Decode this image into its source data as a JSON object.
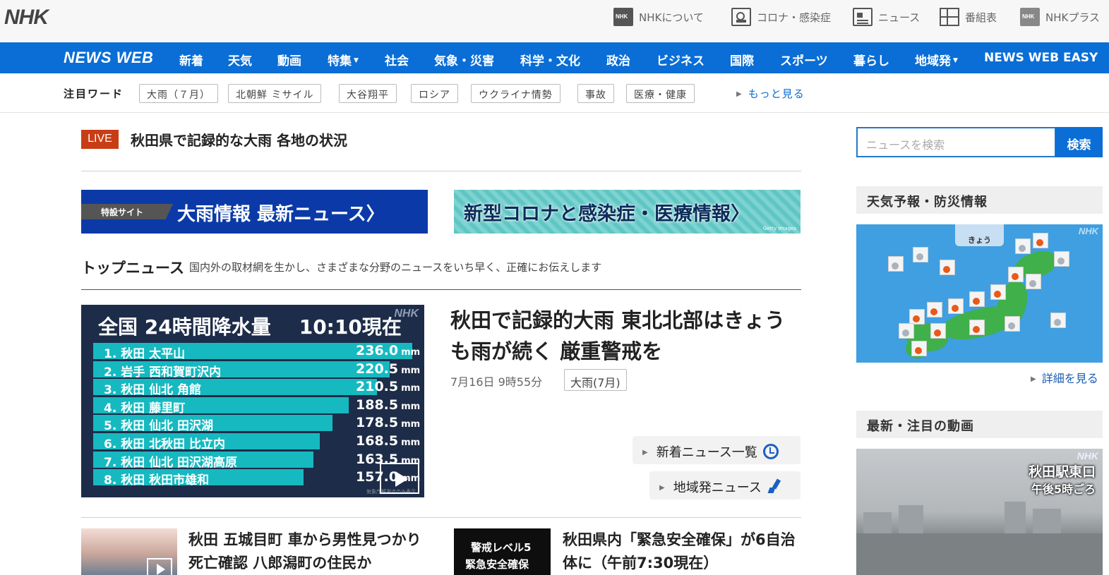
{
  "header": {
    "logo": "NHK",
    "links": [
      {
        "label": "NHKについて",
        "icon": "nhk-logo-icon"
      },
      {
        "label": "コロナ・感染症",
        "icon": "virus-icon"
      },
      {
        "label": "ニュース",
        "icon": "newspaper-icon"
      },
      {
        "label": "番組表",
        "icon": "grid-icon"
      },
      {
        "label": "NHKプラス",
        "icon": "nhk-plus-icon"
      }
    ]
  },
  "nav": {
    "brand": "NEWS WEB",
    "items": [
      "新着",
      "天気",
      "動画",
      "特集",
      "社会",
      "気象・災害",
      "科学・文化",
      "政治",
      "ビジネス",
      "国際",
      "スポーツ",
      "暮らし",
      "地域発",
      "NEWS WEB EASY"
    ]
  },
  "trending": {
    "label": "注目ワード",
    "chips": [
      "大雨（７月）",
      "北朝鮮 ミサイル",
      "大谷翔平",
      "ロシア",
      "ウクライナ情勢",
      "事故",
      "医療・健康"
    ],
    "more": "もっと見る"
  },
  "live": {
    "badge": "LIVE",
    "title": "秋田県で記録的な大雨 各地の状況"
  },
  "banners": {
    "rain_tag": "特設サイト",
    "rain": "大雨情報 最新ニュース〉",
    "covid": "新型コロナと感染症・医療情報〉",
    "covid_credit": "Getty Images"
  },
  "topnews": {
    "title": "トップニュース",
    "subtitle": "国内外の取材網を生かし、さまざまな分野のニュースをいち早く、正確にお伝えします"
  },
  "rain_chart": {
    "title": "全国 24時間降水量",
    "time": "10:10現在",
    "logo": "NHK",
    "unit": "mm",
    "source": "気象庁観測点のみ表示",
    "rows": [
      {
        "label": "1. 秋田 太平山",
        "value": "236.0",
        "fraction": 1.0
      },
      {
        "label": "2. 岩手 西和賀町沢内",
        "value": "220.5",
        "fraction": 0.93
      },
      {
        "label": "3. 秋田 仙北 角館",
        "value": "210.5",
        "fraction": 0.89
      },
      {
        "label": "4. 秋田 藤里町",
        "value": "188.5",
        "fraction": 0.8
      },
      {
        "label": "5. 秋田 仙北 田沢湖",
        "value": "178.5",
        "fraction": 0.75
      },
      {
        "label": "6. 秋田 北秋田 比立内",
        "value": "168.5",
        "fraction": 0.71
      },
      {
        "label": "7. 秋田 仙北 田沢湖高原",
        "value": "163.5",
        "fraction": 0.69
      },
      {
        "label": "8. 秋田 秋田市雄和",
        "value": "157.0",
        "fraction": 0.66
      }
    ]
  },
  "main_story": {
    "title": "秋田で記録的大雨 東北北部はきょうも雨が続く 厳重警戒を",
    "date": "7月16日 9時55分",
    "tag": "大雨(7月)"
  },
  "links": {
    "latest": "新着ニュース一覧",
    "regional": "地域発ニュース"
  },
  "stories": [
    {
      "title": "秋田 五城目町 車から男性見つかり 死亡確認 八郎潟町の住民か"
    },
    {
      "title": "秋田県内「緊急安全確保」が6自治体に（午前7:30現在）",
      "thumb_line1": "警戒レベル5",
      "thumb_line2": "緊急安全確保"
    }
  ],
  "sidebar": {
    "search_placeholder": "ニュースを検索",
    "search_button": "検索",
    "weather_title": "天気予報・防災情報",
    "weather_tab": "きょう",
    "weather_logo": "NHK",
    "details": "詳細を見る",
    "video_title": "最新・注目の動画",
    "video_caption1": "秋田駅東口",
    "video_caption2": "午後5時ごろ",
    "video_logo": "NHK"
  }
}
